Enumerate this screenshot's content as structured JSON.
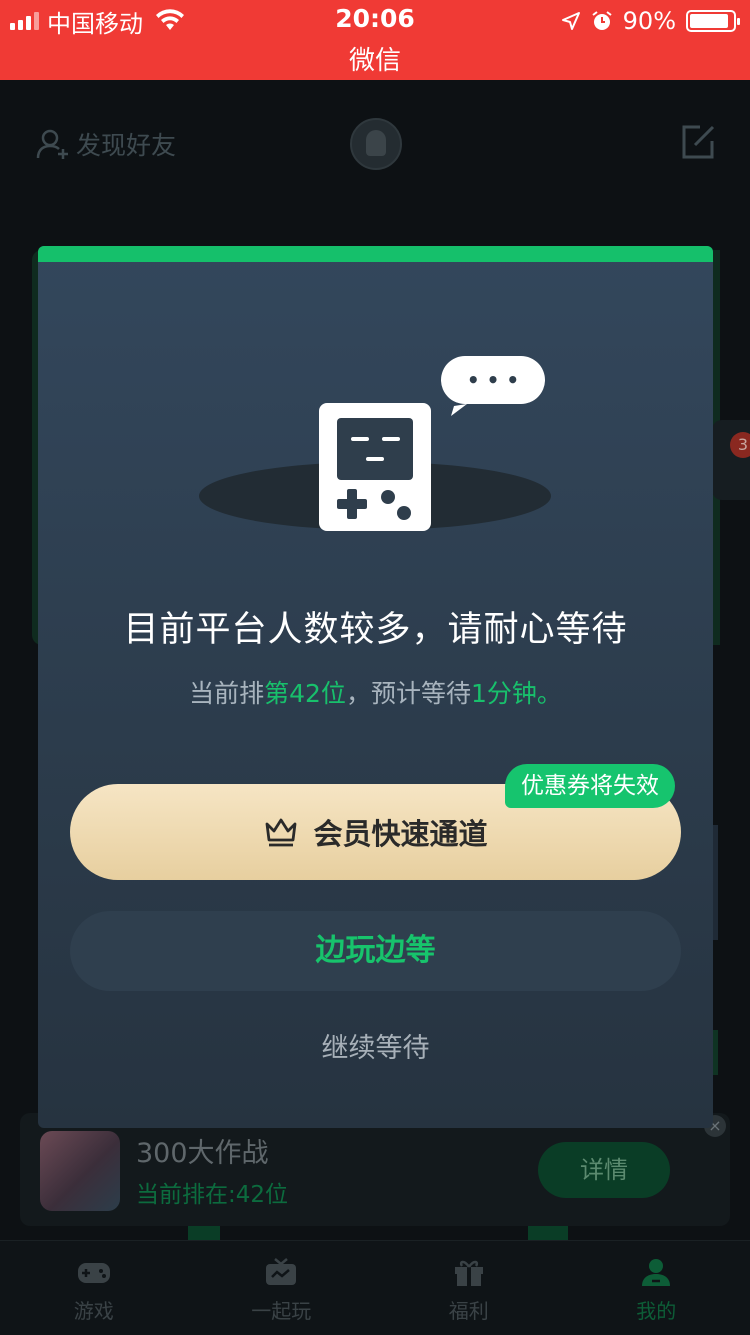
{
  "status_bar": {
    "carrier": "中国移动",
    "time": "20:06",
    "battery": "90%",
    "battery_level": 0.9,
    "app_name": "微信",
    "icons": [
      "signal-icon",
      "wifi-icon",
      "location-icon",
      "alarm-icon",
      "battery-icon"
    ]
  },
  "header": {
    "find_friends": "发现好友",
    "icons": [
      "add-friend-icon",
      "avatar",
      "edit-icon"
    ]
  },
  "background_badge": "3",
  "queue_bar": {
    "game_name": "300大作战",
    "queue_status": "当前排在:42位",
    "detail_button": "详情",
    "close": "×"
  },
  "tabbar": {
    "items": [
      {
        "label": "游戏",
        "icon": "gamepad-icon",
        "active": false
      },
      {
        "label": "一起玩",
        "icon": "tv-icon",
        "active": false
      },
      {
        "label": "福利",
        "icon": "gift-icon",
        "active": false
      },
      {
        "label": "我的",
        "icon": "person-icon",
        "active": true
      }
    ]
  },
  "modal": {
    "title": "目前平台人数较多，请耐心等待",
    "subtitle": {
      "p1": "当前排",
      "rank": "第42位",
      "p2": "，预计等待",
      "eta": "1分钟",
      "p3": "。"
    },
    "bubble_text": "• • •",
    "vip_button": "会员快速通道",
    "coupon_badge": "优惠券将失效",
    "play_button": "边玩边等",
    "continue_link": "继续等待",
    "colors": {
      "accent": "#15c06b",
      "vip_gold": "#ecd6ab"
    }
  }
}
